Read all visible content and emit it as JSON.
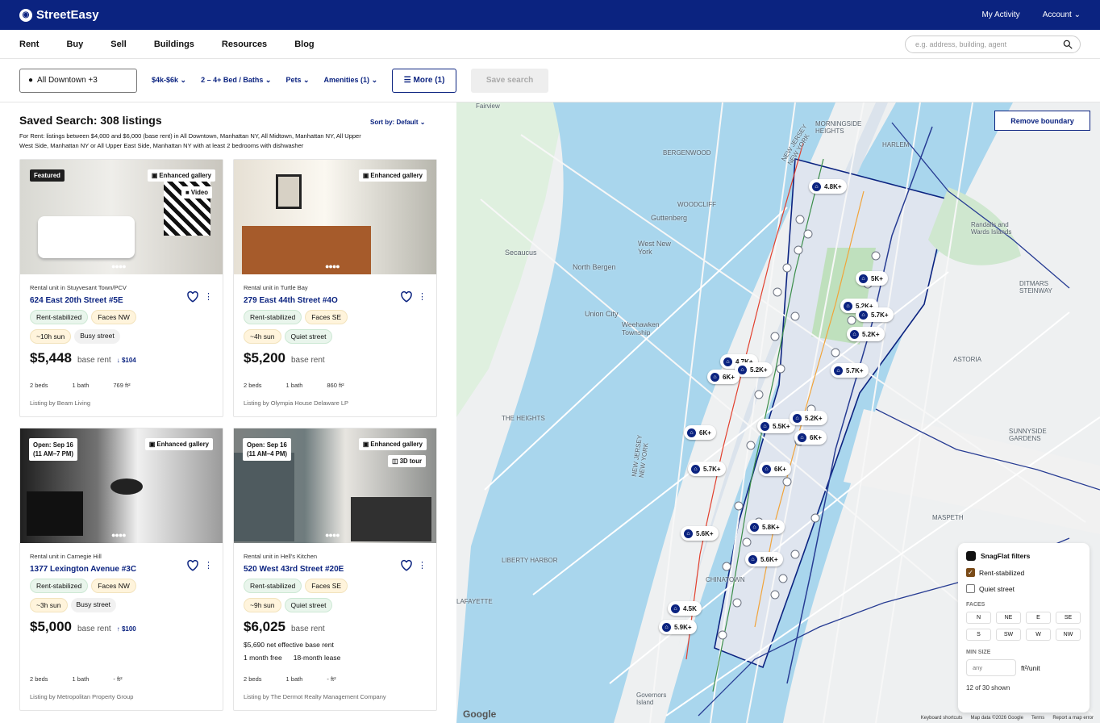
{
  "topbar": {
    "logo": "StreetEasy",
    "my_activity": "My Activity",
    "account": "Account"
  },
  "nav": {
    "items": [
      "Rent",
      "Buy",
      "Sell",
      "Buildings",
      "Resources",
      "Blog"
    ],
    "search_placeholder": "e.g. address, building, agent"
  },
  "filters": {
    "location": "All Downtown +3",
    "price": "$4k-$6k",
    "beds": "2 – 4+ Bed / Baths",
    "pets": "Pets",
    "amenities": "Amenities (1)",
    "more": "More (1)",
    "save": "Save search"
  },
  "results": {
    "title": "Saved Search: 308 listings",
    "sort": "Sort by: Default",
    "description": "For Rent: listings between $4,000 and $6,000 (base rent) in All Downtown, Manhattan NY, All Midtown, Manhattan NY, All Upper West Side, Manhattan NY or All Upper East Side, Manhattan NY with at least 2 bedrooms with dishwasher"
  },
  "listings": [
    {
      "overlay_left": "Featured",
      "overlay_right": "Enhanced gallery",
      "overlay_right2": "Video",
      "unit": "Rental unit in Stuyvesant Town/PCV",
      "address": "624 East 20th Street #5E",
      "badges": [
        "Rent-stabilized",
        "Faces NW",
        "~10h sun",
        "Busy street"
      ],
      "price": "$5,448",
      "base": "base rent",
      "change": "$104",
      "change_dir": "down",
      "beds": "2 beds",
      "baths": "1 bath",
      "sqft": "769 ft²",
      "by": "Listing by Beam Living"
    },
    {
      "overlay_right": "Enhanced gallery",
      "unit": "Rental unit in Turtle Bay",
      "address": "279 East 44th Street #4O",
      "badges": [
        "Rent-stabilized",
        "Faces SE",
        "~4h sun",
        "Quiet street"
      ],
      "price": "$5,200",
      "base": "base rent",
      "beds": "2 beds",
      "baths": "1 bath",
      "sqft": "860 ft²",
      "by": "Listing by Olympia House Delaware LP"
    },
    {
      "open1": "Open: Sep 16",
      "open2": "(11 AM–7 PM)",
      "overlay_right": "Enhanced gallery",
      "unit": "Rental unit in Carnegie Hill",
      "address": "1377 Lexington Avenue #3C",
      "badges": [
        "Rent-stabilized",
        "Faces NW",
        "~3h sun",
        "Busy street"
      ],
      "price": "$5,000",
      "base": "base rent",
      "change": "$100",
      "change_dir": "up",
      "beds": "2 beds",
      "baths": "1 bath",
      "sqft": "- ft²",
      "by": "Listing by Metropolitan Property Group"
    },
    {
      "open1": "Open: Sep 16",
      "open2": "(11 AM–4 PM)",
      "overlay_right": "Enhanced gallery",
      "overlay_right2": "3D tour",
      "unit": "Rental unit in Hell's Kitchen",
      "address": "520 West 43rd Street #20E",
      "badges": [
        "Rent-stabilized",
        "Faces SE",
        "~9h sun",
        "Quiet street"
      ],
      "price": "$6,025",
      "base": "base rent",
      "net": "$5,690 net effective base rent",
      "promo1": "1 month free",
      "promo2": "18-month lease",
      "beds": "2 beds",
      "baths": "1 bath",
      "sqft": "- ft²",
      "by": "Listing by The Dermot Realty Management Company"
    }
  ],
  "map": {
    "remove": "Remove boundary",
    "labels": [
      "Fairview",
      "BERGENWOOD",
      "WOODCLIFF",
      "Guttenberg",
      "West New York",
      "North Bergen",
      "Secaucus",
      "Union City",
      "Weehawken Township",
      "THE HEIGHTS",
      "LIBERTY HARBOR",
      "CHINATOWN",
      "ASTORIA",
      "DITMARS STEINWAY",
      "SUNNYSIDE GARDENS",
      "MASPETH",
      "HARLEM",
      "MORNINGSIDE HEIGHTS",
      "NEW JERSEY NEW YORK",
      "NEW JERSEY NEW YORK",
      "Governors Island",
      "LAFAYETTE",
      "Randalls and Wards Islands"
    ],
    "pins": [
      "4.8K+",
      "5K+",
      "5.2K+",
      "5.7K+",
      "5.2K+",
      "4.7K+",
      "5.2K+",
      "6K+",
      "5.7K+",
      "5.5K+",
      "5.2K+",
      "6K+",
      "6K+",
      "5.7K+",
      "6K+",
      "5.8K+",
      "5.6K+",
      "5.6K+",
      "4.5K",
      "5.9K+"
    ],
    "google": "Google",
    "attr": [
      "Keyboard shortcuts",
      "Map data ©2026 Google",
      "Terms",
      "Report a map error"
    ]
  },
  "snag": {
    "title": "SnagFlat filters",
    "rent": "Rent-stabilized",
    "quiet": "Quiet street",
    "faces_title": "FACES",
    "faces": [
      "N",
      "NE",
      "E",
      "SE",
      "S",
      "SW",
      "W",
      "NW"
    ],
    "min_title": "MIN SIZE",
    "min_placeholder": "any",
    "unit": "ft²/unit",
    "shown": "12 of 30 shown"
  }
}
